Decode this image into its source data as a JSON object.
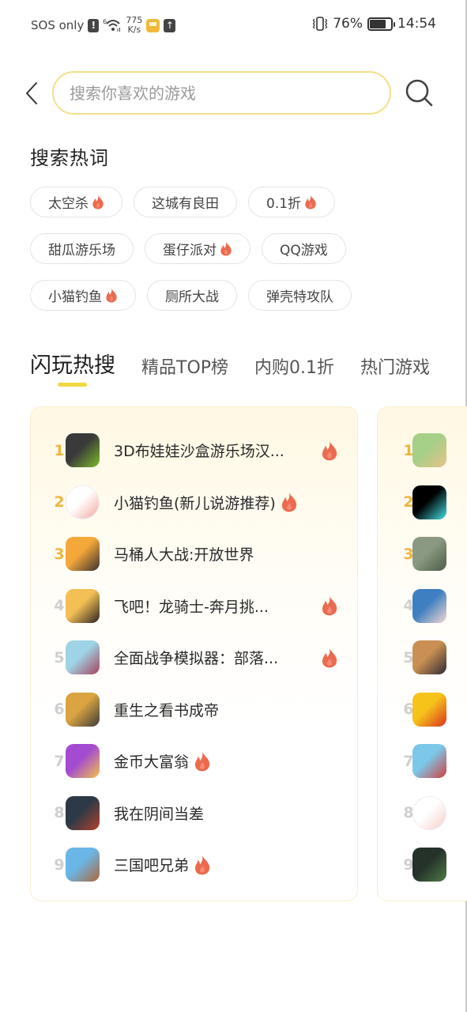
{
  "status_bar": {
    "carrier": "SOS only",
    "network_badge": "6",
    "speed_value": "775",
    "speed_unit": "K/s",
    "battery": "76%",
    "battery_level": 0.76,
    "time": "14:54",
    "icons": [
      "alert-icon",
      "wifi-icon",
      "notification-app-icon",
      "upload-icon",
      "vibrate-icon",
      "battery-icon"
    ]
  },
  "header": {
    "back_icon": "chevron-left-icon",
    "search_placeholder": "搜索你喜欢的游戏",
    "search_value": "",
    "search_icon": "search-icon"
  },
  "hot_words": {
    "title": "搜索热词",
    "rows": [
      [
        {
          "label": "太空杀",
          "hot": true
        },
        {
          "label": "这城有良田",
          "hot": false
        },
        {
          "label": "0.1折",
          "hot": true
        }
      ],
      [
        {
          "label": "甜瓜游乐场",
          "hot": false
        },
        {
          "label": "蛋仔派对",
          "hot": true
        },
        {
          "label": "QQ游戏",
          "hot": false
        }
      ],
      [
        {
          "label": "小猫钓鱼",
          "hot": true
        },
        {
          "label": "厕所大战",
          "hot": false
        },
        {
          "label": "弹壳特攻队",
          "hot": false
        }
      ]
    ]
  },
  "tabs": [
    {
      "label": "闪玩热搜",
      "active": true
    },
    {
      "label": "精品TOP榜",
      "active": false
    },
    {
      "label": "内购0.1折",
      "active": false
    },
    {
      "label": "热门游戏",
      "active": false
    }
  ],
  "colors": {
    "accent_yellow": "#f2d93f",
    "rank_top": "#efb63e",
    "rank_other": "#cfcfcf",
    "flame": "#ec6a4e",
    "search_border": "#f2e08c"
  },
  "rank_lists": [
    {
      "items": [
        {
          "rank": "1",
          "name": "3D布娃娃沙盒游乐场汉...",
          "hot": true,
          "icon_colors": [
            "#3a3a3a",
            "#7dbb2c"
          ]
        },
        {
          "rank": "2",
          "name": "小猫钓鱼(新儿说游推荐)",
          "hot": true,
          "icon_colors": [
            "#ffffff",
            "#f1a7a0"
          ]
        },
        {
          "rank": "3",
          "name": "马桶人大战:开放世界",
          "hot": false,
          "icon_colors": [
            "#f5a83a",
            "#3a3030"
          ]
        },
        {
          "rank": "4",
          "name": "飞吧！龙骑士-奔月挑...",
          "hot": true,
          "icon_colors": [
            "#f3c056",
            "#2b2320"
          ]
        },
        {
          "rank": "5",
          "name": "全面战争模拟器：部落...",
          "hot": true,
          "icon_colors": [
            "#9fd3e6",
            "#a8405a"
          ]
        },
        {
          "rank": "6",
          "name": "重生之看书成帝",
          "hot": false,
          "icon_colors": [
            "#d9a441",
            "#3b3b3b"
          ]
        },
        {
          "rank": "7",
          "name": "金币大富翁",
          "hot": true,
          "icon_colors": [
            "#a34bd1",
            "#f4c24a"
          ]
        },
        {
          "rank": "8",
          "name": "我在阴间当差",
          "hot": false,
          "icon_colors": [
            "#2b3a46",
            "#b3402f"
          ]
        },
        {
          "rank": "9",
          "name": "三国吧兄弟",
          "hot": true,
          "icon_colors": [
            "#6ab6e6",
            "#b0673a"
          ]
        }
      ]
    },
    {
      "items": [
        {
          "rank": "1",
          "icon_colors": [
            "#a6cf88",
            "#e7c387"
          ]
        },
        {
          "rank": "2",
          "icon_colors": [
            "#000000",
            "#43e0e6"
          ]
        },
        {
          "rank": "3",
          "icon_colors": [
            "#8a9a82",
            "#4b5a45"
          ]
        },
        {
          "rank": "4",
          "icon_colors": [
            "#3d7fc0",
            "#f7d8d2"
          ]
        },
        {
          "rank": "5",
          "icon_colors": [
            "#c98f53",
            "#2e2a33"
          ]
        },
        {
          "rank": "6",
          "icon_colors": [
            "#f6c31b",
            "#d9331e"
          ]
        },
        {
          "rank": "7",
          "icon_colors": [
            "#7cc8ea",
            "#d23f3f"
          ]
        },
        {
          "rank": "8",
          "icon_colors": [
            "#ffffff",
            "#f6cfc8"
          ]
        },
        {
          "rank": "9",
          "icon_colors": [
            "#24322a",
            "#4f7a44"
          ]
        }
      ]
    }
  ]
}
